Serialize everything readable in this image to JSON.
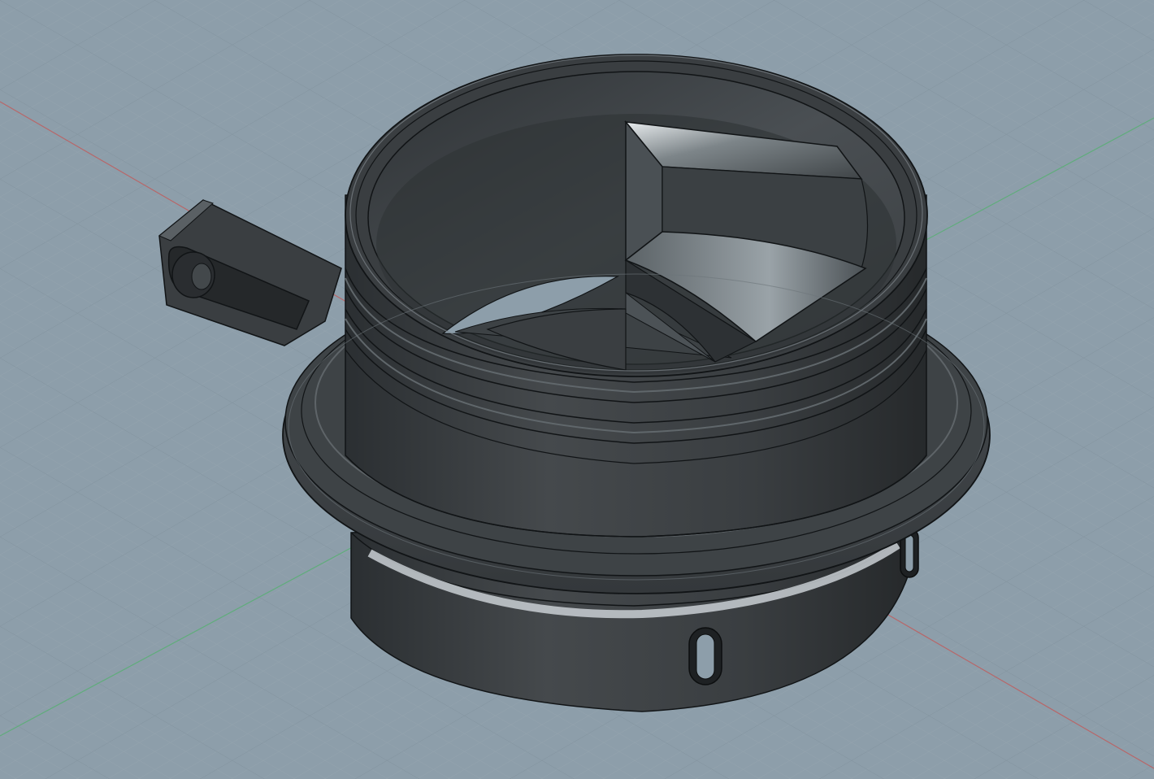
{
  "viewport": {
    "background": "#8d9eaa",
    "grid": true,
    "grid_minor_color": "#93a3ae",
    "grid_major_color": "#7f909c",
    "x_axis_color": "#c25a5a",
    "y_axis_color": "#55b070"
  },
  "model": {
    "body_color": "#3c4043",
    "edge_color": "#111416",
    "highlight_color": "#d9dee1",
    "features": [
      "handle-tab",
      "threaded-neck",
      "flange",
      "lower-skirt",
      "inner-vanes",
      "skirt-slots"
    ]
  }
}
